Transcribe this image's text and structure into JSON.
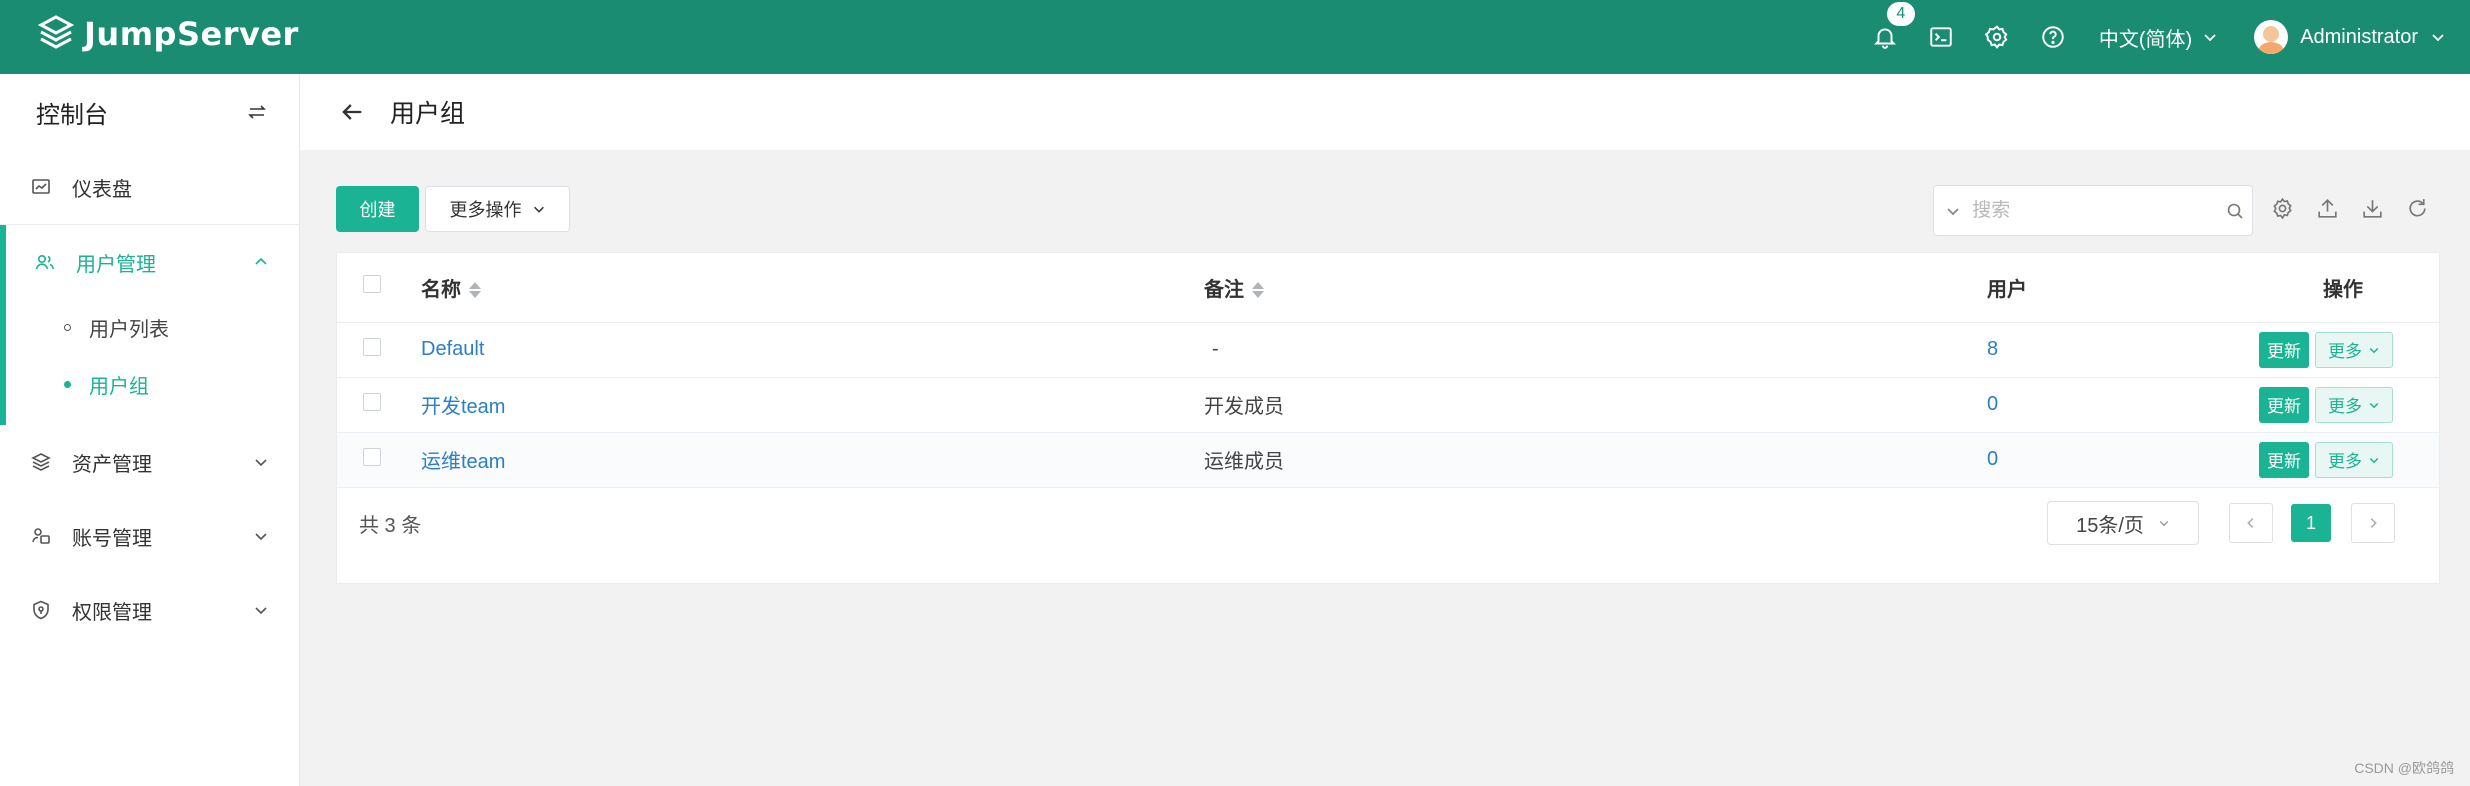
{
  "header": {
    "brand": "JumpServer",
    "notification_count": "4",
    "language": "中文(简体)",
    "user_name": "Administrator",
    "brand_color": "#1a8c72"
  },
  "sidebar": {
    "title": "控制台",
    "items": [
      {
        "label": "仪表盘",
        "icon": "dashboard-icon"
      },
      {
        "label": "用户管理",
        "icon": "users-icon",
        "expanded": true,
        "children": [
          {
            "label": "用户列表"
          },
          {
            "label": "用户组",
            "active": true
          }
        ]
      },
      {
        "label": "资产管理",
        "icon": "assets-icon"
      },
      {
        "label": "账号管理",
        "icon": "accounts-icon"
      },
      {
        "label": "权限管理",
        "icon": "shield-icon"
      }
    ]
  },
  "page": {
    "title": "用户组"
  },
  "toolbar": {
    "create_label": "创建",
    "more_label": "更多操作",
    "search_placeholder": "搜索"
  },
  "table": {
    "columns": [
      "名称",
      "备注",
      "用户",
      "操作"
    ],
    "rows": [
      {
        "name": "Default",
        "note": "-",
        "users": "8"
      },
      {
        "name": "开发team",
        "note": "开发成员",
        "users": "0"
      },
      {
        "name": "运维team",
        "note": "运维成员",
        "users": "0"
      }
    ],
    "update_label": "更新",
    "more_label": "更多"
  },
  "pagination": {
    "total_text": "共 3 条",
    "page_size": "15条/页",
    "current_page": "1"
  },
  "watermark": "CSDN @欧鸽鸽"
}
